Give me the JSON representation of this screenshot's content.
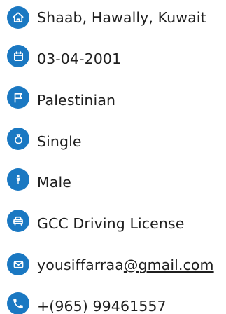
{
  "colors": {
    "icon_bg": "#1a78c2",
    "text": "#1f1f1f"
  },
  "profile": {
    "address": "Shaab, Hawally, Kuwait",
    "birth_date": "03-04-2001",
    "nationality": "Palestinian",
    "marital_status": "Single",
    "gender": "Male",
    "license": "GCC Driving License",
    "email_user": "yousiffarraa",
    "email_domain": "@gmail.com",
    "phone": "+(965) 99461557"
  },
  "icons": {
    "address": "home-icon",
    "birth_date": "calendar-icon",
    "nationality": "flag-icon",
    "marital_status": "ring-icon",
    "gender": "person-icon",
    "license": "car-icon",
    "email": "mail-icon",
    "phone": "phone-icon"
  }
}
